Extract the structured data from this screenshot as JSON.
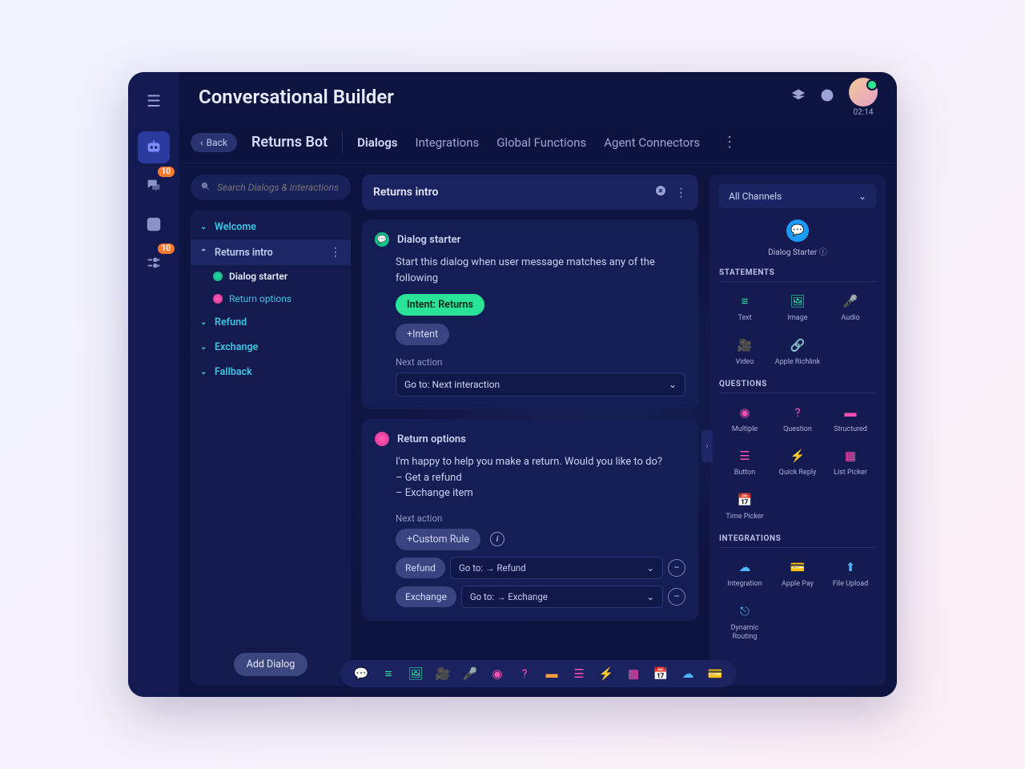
{
  "header": {
    "title": "Conversational Builder",
    "timer": "02:14"
  },
  "tabbar": {
    "back": "Back",
    "bot_name": "Returns Bot",
    "tabs": [
      "Dialogs",
      "Integrations",
      "Global Functions",
      "Agent Connectors"
    ]
  },
  "search": {
    "placeholder": "Search Dialogs & Interactions"
  },
  "tree": {
    "items": [
      {
        "label": "Welcome"
      },
      {
        "label": "Returns intro",
        "children": [
          {
            "label": "Dialog starter"
          },
          {
            "label": "Return options"
          }
        ]
      },
      {
        "label": "Refund"
      },
      {
        "label": "Exchange"
      },
      {
        "label": "Fallback"
      }
    ],
    "add_btn": "Add Dialog"
  },
  "canvas_header": "Returns intro",
  "dialog_starter": {
    "title": "Dialog starter",
    "desc": "Start this dialog when user message matches any of the following",
    "intent_pill": "Intent: Returns",
    "add_intent": "+Intent",
    "next_label": "Next action",
    "next_value": "Go to: Next interaction"
  },
  "return_options": {
    "title": "Return options",
    "body_l1": "I'm happy to help you make a return. Would you like to do?",
    "body_l2": "– Get a refund",
    "body_l3": "– Exchange item",
    "next_label": "Next action",
    "custom_rule": "+Custom Rule",
    "rules": [
      {
        "tag": "Refund",
        "goto": "Go to: → Refund"
      },
      {
        "tag": "Exchange",
        "goto": "Go to: → Exchange"
      }
    ]
  },
  "palette": {
    "channel": "All Channels",
    "starter": "Dialog Starter",
    "sect_statements": "STATEMENTS",
    "statements": [
      "Text",
      "Image",
      "Audio",
      "Video",
      "Apple Richlink"
    ],
    "sect_questions": "QUESTIONS",
    "questions": [
      "Multiple",
      "Question",
      "Structured",
      "Button",
      "Quick Reply",
      "List Picker",
      "Time Picker"
    ],
    "sect_integrations": "INTEGRATIONS",
    "integrations": [
      "Integration",
      "Apple Pay",
      "File Upload",
      "Dynamic Routing"
    ]
  },
  "rail_badges": {
    "chat": "10",
    "flow": "10"
  }
}
